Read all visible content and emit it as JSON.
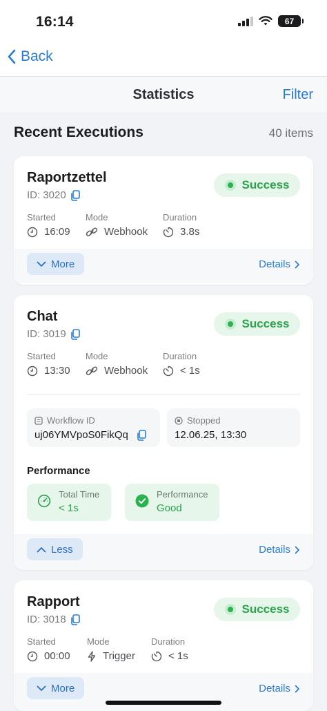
{
  "status_bar": {
    "time": "16:14",
    "battery": "67"
  },
  "nav": {
    "back_label": "Back"
  },
  "header": {
    "title": "Statistics",
    "filter_label": "Filter"
  },
  "section": {
    "title": "Recent Executions",
    "count": "40 items"
  },
  "labels": {
    "started": "Started",
    "mode": "Mode",
    "duration": "Duration",
    "details": "Details",
    "more": "More",
    "less": "Less",
    "workflow_id": "Workflow ID",
    "stopped": "Stopped",
    "performance": "Performance",
    "total_time": "Total Time",
    "perf_metric": "Performance"
  },
  "executions": [
    {
      "name": "Raportzettel",
      "id": "ID: 3020",
      "status": "Success",
      "started": "16:09",
      "mode": "Webhook",
      "duration": "3.8s"
    },
    {
      "name": "Chat",
      "id": "ID: 3019",
      "status": "Success",
      "started": "13:30",
      "mode": "Webhook",
      "duration": "< 1s",
      "workflow_id": "uj06YMVpoS0FikQq",
      "stopped": "12.06.25, 13:30",
      "total_time": "< 1s",
      "performance": "Good"
    },
    {
      "name": "Rapport",
      "id": "ID: 3018",
      "status": "Success",
      "started": "00:00",
      "mode": "Trigger",
      "duration": "< 1s"
    }
  ],
  "colors": {
    "accent": "#2a7bd6",
    "success": "#2aa14b",
    "success_bg": "#e6f6ea"
  }
}
